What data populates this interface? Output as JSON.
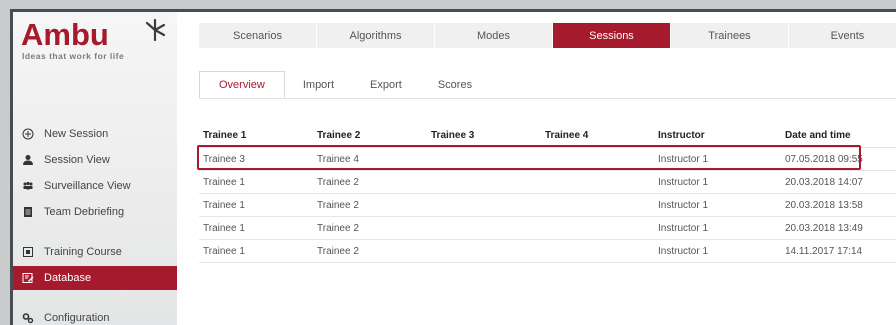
{
  "logo": {
    "word": "Ambu",
    "tagline": "Ideas that work for life"
  },
  "sidebar": {
    "items": [
      {
        "label": "New Session",
        "icon": "plus-circle-icon"
      },
      {
        "label": "Session View",
        "icon": "person-icon"
      },
      {
        "label": "Surveillance View",
        "icon": "group-icon"
      },
      {
        "label": "Team Debriefing",
        "icon": "document-icon"
      },
      {
        "label": "Training Course",
        "icon": "course-icon"
      },
      {
        "label": "Database",
        "icon": "database-edit-icon",
        "active": true
      },
      {
        "label": "Configuration",
        "icon": "gears-icon"
      }
    ]
  },
  "tabs": [
    {
      "label": "Scenarios"
    },
    {
      "label": "Algorithms"
    },
    {
      "label": "Modes"
    },
    {
      "label": "Sessions",
      "active": true
    },
    {
      "label": "Trainees"
    },
    {
      "label": "Events"
    }
  ],
  "subtabs": [
    {
      "label": "Overview",
      "active": true
    },
    {
      "label": "Import"
    },
    {
      "label": "Export"
    },
    {
      "label": "Scores"
    }
  ],
  "table": {
    "headers": [
      "Trainee 1",
      "Trainee 2",
      "Trainee 3",
      "Trainee 4",
      "Instructor",
      "Date and time"
    ],
    "rows": [
      [
        "Trainee 3",
        "Trainee 4",
        "",
        "",
        "Instructor 1",
        "07.05.2018 09:55"
      ],
      [
        "Trainee 1",
        "Trainee 2",
        "",
        "",
        "Instructor 1",
        "20.03.2018 14:07"
      ],
      [
        "Trainee 1",
        "Trainee 2",
        "",
        "",
        "Instructor 1",
        "20.03.2018 13:58"
      ],
      [
        "Trainee 1",
        "Trainee 2",
        "",
        "",
        "Instructor 1",
        "20.03.2018 13:49"
      ],
      [
        "Trainee 1",
        "Trainee 2",
        "",
        "",
        "Instructor 1",
        "14.11.2017 17:14"
      ]
    ]
  },
  "colors": {
    "brand": "#a51a2c",
    "sidebar_bg": "#eeeeee",
    "tab_bg": "#f0f0f0"
  }
}
